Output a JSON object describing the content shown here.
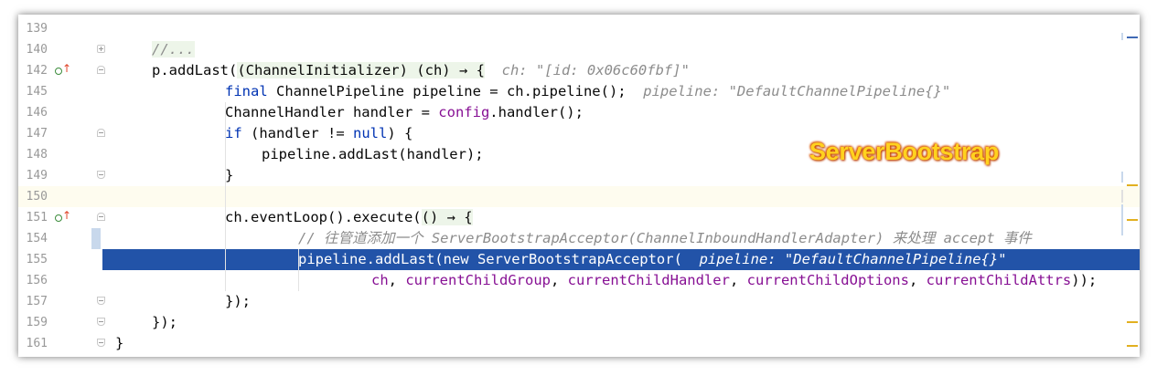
{
  "editor": {
    "overlay_title": "ServerBootstrap",
    "lines": [
      {
        "no": "139",
        "text": ""
      },
      {
        "no": "140",
        "text": "//..."
      },
      {
        "no": "142",
        "text_parts": [
          "p.addLast(",
          "(ChannelInitializer) (ch) → {",
          "  ch: \"[id: 0x06c60fbf]\""
        ]
      },
      {
        "no": "145",
        "text_parts": [
          "final",
          " ChannelPipeline pipeline = ch.pipeline();",
          "  pipeline: \"DefaultChannelPipeline{}\""
        ]
      },
      {
        "no": "146",
        "text_parts": [
          "ChannelHandler handler = ",
          "config",
          ".handler();"
        ]
      },
      {
        "no": "147",
        "text_parts": [
          "if",
          " (handler != ",
          "null",
          ") {"
        ]
      },
      {
        "no": "148",
        "text": "pipeline.addLast(handler);"
      },
      {
        "no": "149",
        "text": "}"
      },
      {
        "no": "150",
        "text": ""
      },
      {
        "no": "151",
        "text_parts": [
          "ch.eventLoop().execute(",
          "() → {"
        ]
      },
      {
        "no": "154",
        "text": "// 往管道添加一个 ServerBootstrapAcceptor(ChannelInboundHandlerAdapter) 来处理 accept 事件"
      },
      {
        "no": "155",
        "text_parts": [
          "pipeline.addLast(new ServerBootstrapAcceptor(",
          "  pipeline: \"DefaultChannelPipeline{}\""
        ]
      },
      {
        "no": "156",
        "text_parts": [
          "ch",
          ", ",
          "currentChildGroup",
          ", ",
          "currentChildHandler",
          ", ",
          "currentChildOptions",
          ", ",
          "currentChildAttrs",
          "));"
        ]
      },
      {
        "no": "157",
        "text": "});"
      },
      {
        "no": "159",
        "text": "});"
      },
      {
        "no": "161",
        "text": "}"
      }
    ]
  },
  "colors": {
    "keyword": "#0033b3",
    "field": "#871094",
    "selection": "#2253a8",
    "current_line": "#fefcef",
    "hint": "#8c8c8c"
  },
  "icons": [
    "override-up-arrow-icon",
    "fold-icon"
  ]
}
